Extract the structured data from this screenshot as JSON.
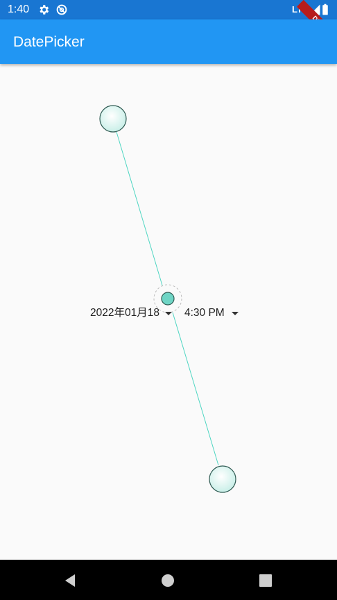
{
  "status_bar": {
    "time": "1:40",
    "network": "LTE",
    "icons": [
      "settings-icon",
      "sync-icon",
      "signal-icon",
      "battery-icon"
    ],
    "debug_label": "DEBUG"
  },
  "app_bar": {
    "title": "DatePicker",
    "color": "#2196f3"
  },
  "picker": {
    "date_value": "2022年01月18",
    "time_value": "4:30 PM"
  },
  "drag_handles": [
    "top-drag-handle",
    "center-drag-handle",
    "bottom-drag-handle"
  ],
  "nav_bar": {
    "buttons": [
      "back-icon",
      "home-icon",
      "recents-icon"
    ]
  }
}
